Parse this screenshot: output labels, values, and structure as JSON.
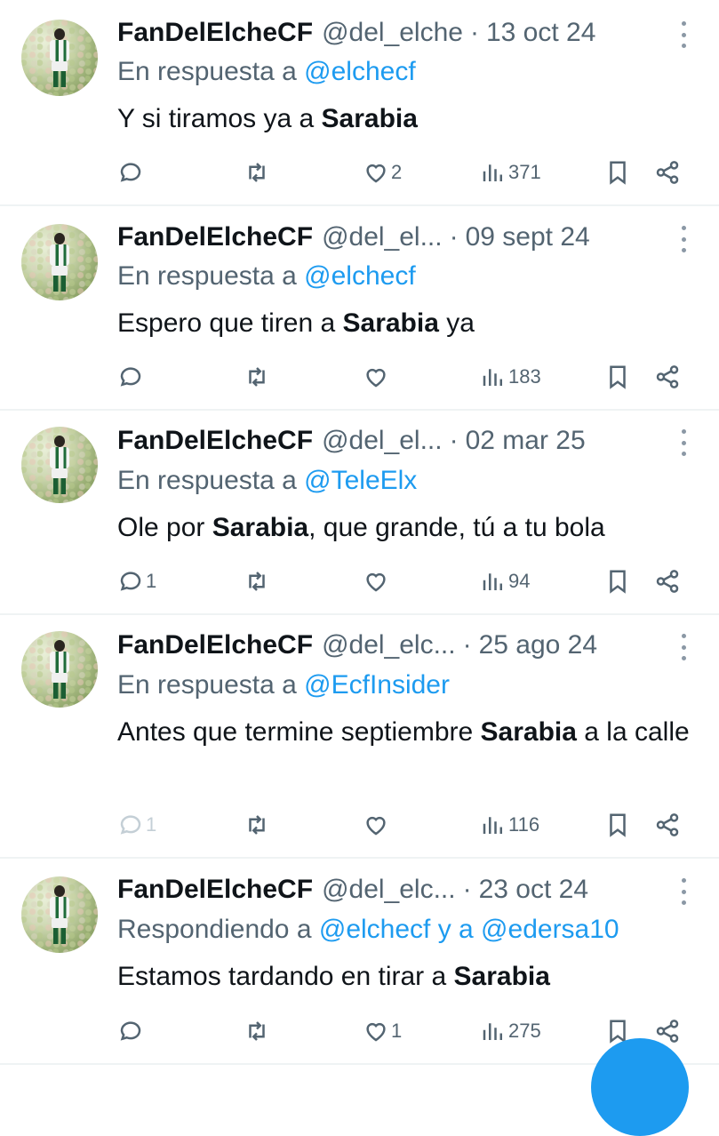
{
  "tweets": [
    {
      "name": "FanDelElcheCF",
      "handle": "@del_elche",
      "separator": "·",
      "date": "13 oct 24",
      "reply_prefix": "En respuesta a",
      "reply_targets": "@elchecf",
      "text_before": "Y si tiramos ya a ",
      "text_bold": "Sarabia",
      "text_after": "",
      "replies": "",
      "retweets": "",
      "likes": "2",
      "views": "371"
    },
    {
      "name": "FanDelElcheCF",
      "handle": "@del_el...",
      "separator": "·",
      "date": "09 sept 24",
      "reply_prefix": "En respuesta a",
      "reply_targets": "@elchecf",
      "text_before": "Espero que tiren a ",
      "text_bold": "Sarabia",
      "text_after": " ya",
      "replies": "",
      "retweets": "",
      "likes": "",
      "views": "183"
    },
    {
      "name": "FanDelElcheCF",
      "handle": "@del_el...",
      "separator": "·",
      "date": "02 mar 25",
      "reply_prefix": "En respuesta a",
      "reply_targets": "@TeleElx",
      "text_before": "Ole por ",
      "text_bold": "Sarabia",
      "text_after": ", que grande, tú a tu bola",
      "replies": "1",
      "retweets": "",
      "likes": "",
      "views": "94"
    },
    {
      "name": "FanDelElcheCF",
      "handle": "@del_elc...",
      "separator": "·",
      "date": "25 ago 24",
      "reply_prefix": "En respuesta a",
      "reply_targets": "@EcfInsider",
      "text_before": "Antes que termine septiembre ",
      "text_bold": "Sarabia",
      "text_after": " a la calle",
      "replies": "1",
      "retweets": "",
      "likes": "",
      "views": "116"
    },
    {
      "name": "FanDelElcheCF",
      "handle": "@del_elc...",
      "separator": "·",
      "date": "23 oct 24",
      "reply_prefix": "Respondiendo a",
      "reply_targets": "@elchecf y a @edersa10",
      "text_before": "Estamos tardando en tirar a ",
      "text_bold": "Sarabia",
      "text_after": "",
      "replies": "",
      "retweets": "",
      "likes": "1",
      "views": "275"
    }
  ],
  "icons": {
    "reply": "reply-bubble-icon",
    "retweet": "retweet-icon",
    "like": "heart-icon",
    "views": "views-chart-icon",
    "bookmark": "bookmark-icon",
    "share": "share-icon",
    "more": "more-dots-icon"
  },
  "colors": {
    "text": "#0f1419",
    "secondary": "#536471",
    "link": "#1d9bf0",
    "divider": "#eff3f4",
    "fab": "#1d9bf0"
  }
}
